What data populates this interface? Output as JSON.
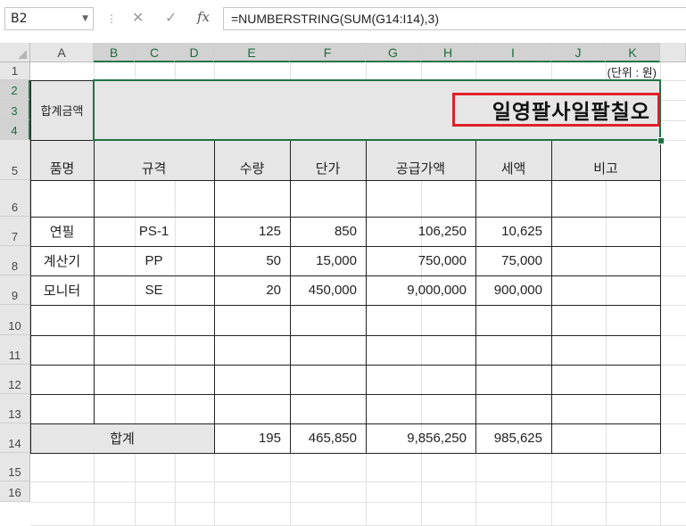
{
  "formula_bar": {
    "name_box": "B2",
    "cancel_symbol": "✕",
    "enter_symbol": "✓",
    "fx_symbol": "fx",
    "formula": "=NUMBERSTRING(SUM(G14:I14),3)"
  },
  "columns": [
    "A",
    "B",
    "C",
    "D",
    "E",
    "F",
    "G",
    "H",
    "I",
    "J",
    "K"
  ],
  "rows": [
    "1",
    "2",
    "3",
    "4",
    "5",
    "6",
    "7",
    "8",
    "9",
    "10",
    "11",
    "12",
    "13",
    "14",
    "15",
    "16"
  ],
  "sheet": {
    "unit_note": "(단위 : 원)",
    "total_amount_label": "합계금액",
    "total_amount_text": "일영팔사일팔칠오",
    "headers": [
      "품명",
      "규격",
      "수량",
      "단가",
      "공급가액",
      "세액",
      "비고"
    ],
    "items": [
      {
        "name": "연필",
        "spec": "PS-1",
        "qty": "125",
        "price": "850",
        "supply": "106,250",
        "tax": "10,625"
      },
      {
        "name": "계산기",
        "spec": "PP",
        "qty": "50",
        "price": "15,000",
        "supply": "750,000",
        "tax": "75,000"
      },
      {
        "name": "모니터",
        "spec": "SE",
        "qty": "20",
        "price": "450,000",
        "supply": "9,000,000",
        "tax": "900,000"
      }
    ],
    "total_row": {
      "label": "합계",
      "qty": "195",
      "price": "465,850",
      "supply": "9,856,250",
      "tax": "985,625"
    }
  },
  "colors": {
    "selection": "#217346",
    "highlight_box": "#e0202a",
    "header_fill": "#e6e6e6"
  }
}
